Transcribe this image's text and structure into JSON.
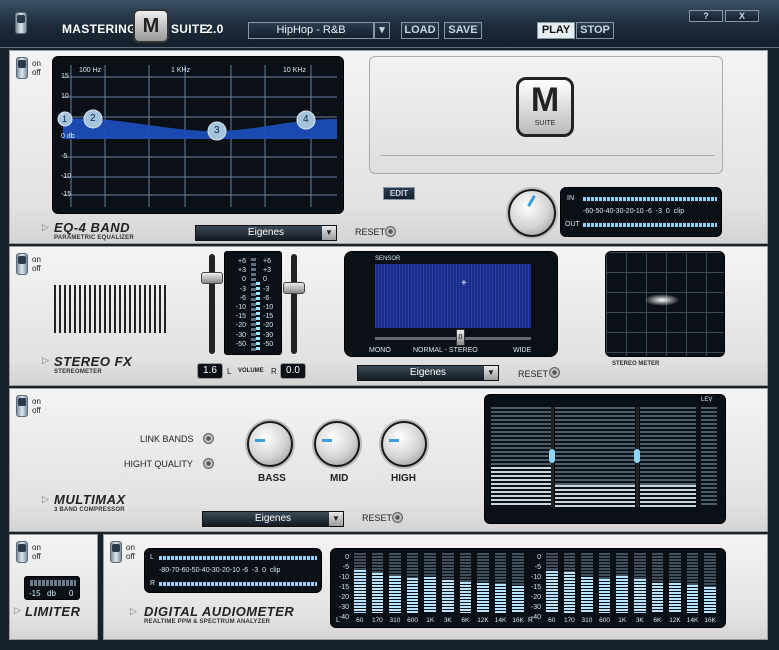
{
  "titlebar": {
    "app_name_left": "MASTERING",
    "app_name_right": "SUITE",
    "version": "2.0",
    "preset": "HipHop - R&B",
    "load": "LOAD",
    "save": "SAVE",
    "play": "PLAY",
    "stop": "STOP",
    "help": "?",
    "close": "X",
    "logo_text": "M"
  },
  "onoff": {
    "on": "on",
    "off": "off"
  },
  "eq": {
    "freq_labels": [
      "100 Hz",
      "1 KHz",
      "10 KHz"
    ],
    "db_labels": [
      "15",
      "10",
      "5",
      "0 db",
      "-5",
      "-10",
      "-15"
    ],
    "bands": [
      "1",
      "2",
      "3",
      "4"
    ],
    "title": "EQ-4 BAND",
    "subtitle": "PARAMETRIC EQUALIZER",
    "preset": "Eigenes",
    "reset": "RESET",
    "edit": "EDIT",
    "logo_sub": "SUITE",
    "meter_in": "IN",
    "meter_out": "OUT",
    "meter_scale": "-60-50-40-30-20-10 -6  -3  0  clip"
  },
  "stereo": {
    "scale_left": [
      "+6",
      "+3",
      "0",
      "-3",
      "-6",
      "-10",
      "-15",
      "-20",
      "-30",
      "-50"
    ],
    "scale_right": [
      "+6",
      "+3",
      "0",
      "-3",
      "-6",
      "-10",
      "-15",
      "-20",
      "-30",
      "-50"
    ],
    "left_value": "1.6",
    "right_value": "0.0",
    "volume_l": "L",
    "volume": "VOLUME",
    "volume_r": "R",
    "sensor": "SENSOR",
    "mode_mono": "MONO",
    "mode_normal": "NORMAL - STEREO",
    "mode_wide": "WIDE",
    "slider_value": "0",
    "title": "STEREO FX",
    "subtitle": "STEREOMETER",
    "preset": "Eigenes",
    "reset": "RESET",
    "meter_label": "STEREO METER"
  },
  "multimax": {
    "link_bands": "LINK BANDS",
    "high_quality": "HIGHT QUALITY",
    "bass": "BASS",
    "mid": "MID",
    "high": "HIGH",
    "lev": "LEV",
    "title": "MULTIMAX",
    "subtitle": "3 BAND COMPRESSOR",
    "preset": "Eigenes",
    "reset": "RESET"
  },
  "limiter": {
    "value": "-15",
    "unit": "db",
    "zero": "0",
    "title": "LIMITER"
  },
  "audiometer": {
    "l": "L",
    "r": "R",
    "scale": "-80-70-60-50-40-30-20-10 -6  -3  0  clip",
    "title": "DIGITAL AUDIOMETER",
    "subtitle": "REALTIME PPM & SPECTRUM ANALYZER",
    "spec_scale": [
      "0",
      "-5",
      "-10",
      "-15",
      "-20",
      "-30",
      "-40"
    ],
    "freqs_l": [
      "60",
      "170",
      "310",
      "600",
      "1K",
      "3K",
      "6K",
      "12K",
      "14K",
      "16K"
    ],
    "freqs_r": [
      "60",
      "170",
      "310",
      "600",
      "1K",
      "3K",
      "6K",
      "12K",
      "14K",
      "16K"
    ],
    "l_label": "L",
    "r_label": "R",
    "levels_l": [
      0.72,
      0.66,
      0.62,
      0.58,
      0.6,
      0.55,
      0.52,
      0.5,
      0.48,
      0.45
    ],
    "levels_r": [
      0.7,
      0.68,
      0.6,
      0.57,
      0.62,
      0.56,
      0.5,
      0.5,
      0.46,
      0.44
    ]
  },
  "colors": {
    "accent": "#5ec8ff",
    "eq_fill": "#1b4db8",
    "play_active": "#1c2a38"
  }
}
